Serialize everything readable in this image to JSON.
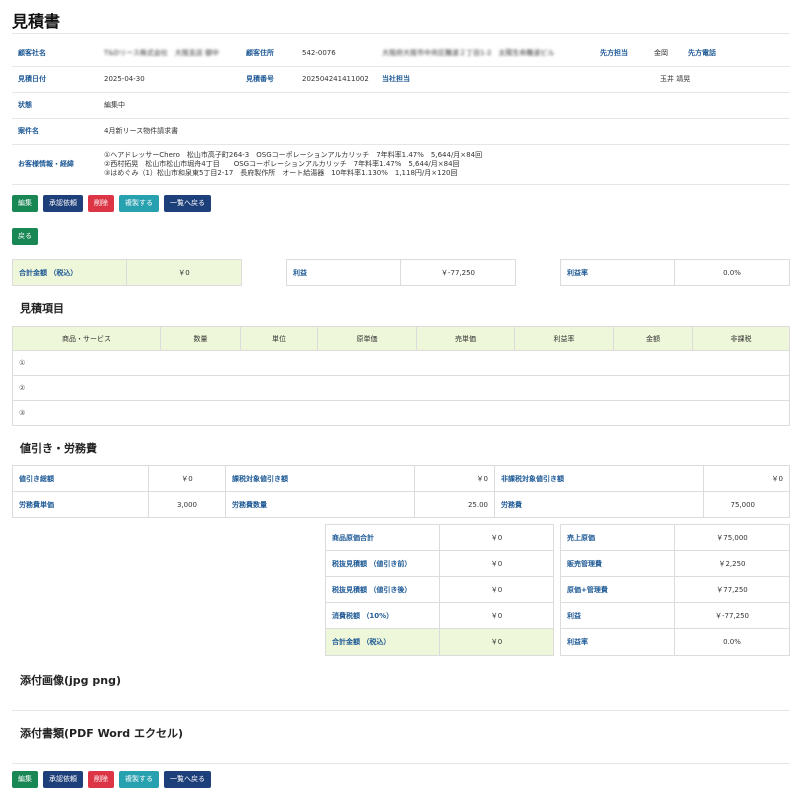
{
  "title": "見積書",
  "info": {
    "customer_name_label": "顧客社名",
    "customer_name": "T&Dリース株式会社　大阪支店 御中",
    "customer_address_label": "顧客住所",
    "postal_code": "542-0076",
    "address": "大阪府大阪市中央区難波２丁目1-2　太陽生命難波ビル",
    "contact_label": "先方担当",
    "contact": "金岡",
    "phone_label": "先方電話",
    "quote_date_label": "見積日付",
    "quote_date": "2025-04-30",
    "quote_number_label": "見積番号",
    "quote_number": "202504241411002",
    "our_rep_label": "当社担当",
    "our_rep": "玉井 靖晃",
    "status_label": "状態",
    "status": "編集中",
    "case_label": "案件名",
    "case_name": "4月新リース物件請求書",
    "history_label": "お客様情報・経緯",
    "history": [
      "①ヘアドレッサーChero　松山市高子町264-3　OSGコーポレーションアルカリッチ　7年料率1.47%　5,644/月×84回",
      "②西村拓晃　松山市松山市堀舟4丁目　　OSGコーポレーションアルカリッチ　7年料率1.47%　5,644/月×84回",
      "③はめぐみ（1）松山市和泉東5丁目2-17　長府製作所　オート給湯器　10年料率1.130%　1,118円/月×120回"
    ]
  },
  "buttons": {
    "edit": "編集",
    "approve": "承認依頼",
    "delete": "削除",
    "duplicate": "複製する",
    "back_list": "一覧へ戻る",
    "back": "戻る"
  },
  "summary": {
    "total_label": "合計金額 （税込）",
    "total": "￥0",
    "profit_label": "利益",
    "profit": "￥-77,250",
    "margin_label": "利益率",
    "margin": "0.0%"
  },
  "items": {
    "title": "見積項目",
    "headers": [
      "商品・サービス",
      "数量",
      "単位",
      "原単価",
      "売単価",
      "利益率",
      "金額",
      "非課税"
    ],
    "rows": [
      "①",
      "②",
      "③"
    ]
  },
  "discount": {
    "title": "値引き・労務費",
    "total_discount_label": "値引き総額",
    "total_discount": "￥0",
    "taxable_discount_label": "課税対象値引き額",
    "taxable_discount": "￥0",
    "nontaxable_discount_label": "非課税対象値引き額",
    "nontaxable_discount": "￥0",
    "labor_unit_label": "労務費単価",
    "labor_unit": "3,000",
    "labor_qty_label": "労務費数量",
    "labor_qty": "25.00",
    "labor_cost_label": "労務費",
    "labor_cost": "75,000"
  },
  "totals_left": [
    {
      "label": "商品原価合計",
      "value": "￥0"
    },
    {
      "label": "税抜見積額 （値引き前）",
      "value": "￥0"
    },
    {
      "label": "税抜見積額 （値引き後）",
      "value": "￥0"
    },
    {
      "label": "消費税額 （10%）",
      "value": "￥0"
    },
    {
      "label": "合計金額 （税込）",
      "value": "￥0"
    }
  ],
  "totals_right": [
    {
      "label": "売上原価",
      "value": "￥75,000"
    },
    {
      "label": "販売管理費",
      "value": "￥2,250"
    },
    {
      "label": "原価+管理費",
      "value": "￥77,250"
    },
    {
      "label": "利益",
      "value": "￥-77,250"
    },
    {
      "label": "利益率",
      "value": "0.0%"
    }
  ],
  "attachments": {
    "images_title": "添付画像(jpg png)",
    "docs_title": "添付書類(PDF Word エクセル)"
  }
}
